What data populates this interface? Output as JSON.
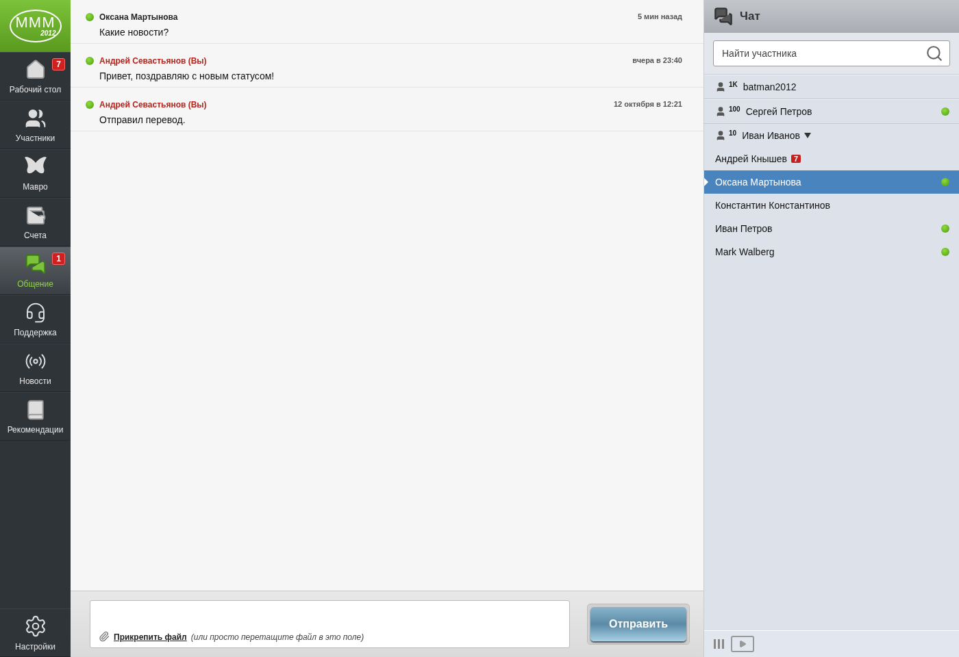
{
  "logo": {
    "letters": "MMM",
    "year": "2012"
  },
  "nav": [
    {
      "kind": "home",
      "label": "Рабочий стол",
      "badge": "7",
      "selected": false
    },
    {
      "kind": "people",
      "label": "Участники",
      "selected": false
    },
    {
      "kind": "butterfly",
      "label": "Мавро",
      "selected": false
    },
    {
      "kind": "wallet",
      "label": "Счета",
      "selected": false
    },
    {
      "kind": "chat",
      "label": "Общение",
      "badge": "1",
      "selected": true
    },
    {
      "kind": "support",
      "label": "Поддержка",
      "selected": false
    },
    {
      "kind": "radio",
      "label": "Новости",
      "selected": false
    },
    {
      "kind": "book",
      "label": "Рекомендации",
      "selected": false
    }
  ],
  "settings": {
    "label": "Настройки"
  },
  "messages": [
    {
      "sender": "Оксана Мартынова",
      "own": false,
      "online": true,
      "time": "5 мин назад",
      "text": "Какие новости?"
    },
    {
      "sender": "Андрей Севастьянов (Вы)",
      "own": true,
      "online": true,
      "time": "вчера в 23:40",
      "text": "Привет, поздравляю с новым статусом!"
    },
    {
      "sender": "Андрей Севастьянов (Вы)",
      "own": true,
      "online": true,
      "time": "12 октября в 12:21",
      "text": "Отправил перевод."
    }
  ],
  "composer": {
    "attach_link": "Прикрепить файл",
    "attach_hint": "(или просто перетащите файл в это поле)",
    "send": "Отправить"
  },
  "chat": {
    "title": "Чат",
    "search": {
      "placeholder": "Найти участника"
    },
    "contacts": [
      {
        "rank": "1K",
        "name": "batman2012",
        "online": false,
        "selected": false
      },
      {
        "rank": "100",
        "name": "Сергей Петров",
        "online": true,
        "selected": false
      },
      {
        "rank": "10",
        "name": "Иван Иванов",
        "online": false,
        "selected": false,
        "expanded": true,
        "children": [
          {
            "name": "Андрей Кнышев",
            "badge": "7",
            "online": false,
            "selected": false
          },
          {
            "name": "Оксана Мартынова",
            "online": true,
            "selected": true
          },
          {
            "name": "Константин Константинов",
            "online": false,
            "selected": false
          },
          {
            "name": "Иван Петров",
            "online": true,
            "selected": false
          },
          {
            "name": "Mark Walberg",
            "online": true,
            "selected": false
          }
        ]
      }
    ]
  }
}
